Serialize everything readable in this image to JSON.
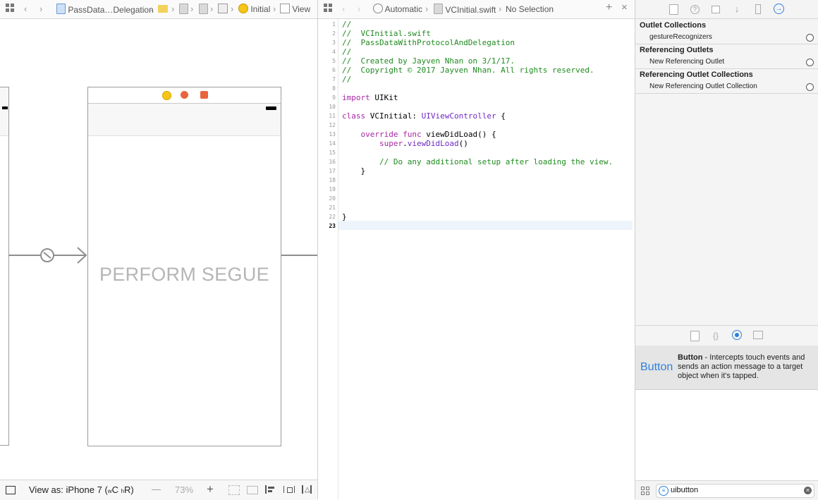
{
  "storyboard_jumpbar": {
    "project": "PassData…Delegation",
    "scene": "Initial",
    "view": "View"
  },
  "scene": {
    "title": "PERFORM SEGUE"
  },
  "storyboard_bottom": {
    "view_as": "View as: iPhone 7 (",
    "size_w": "w",
    "size_c": "C",
    "size_h": "h",
    "size_r": "R)",
    "minus": "—",
    "zoom": "73%",
    "plus": "+"
  },
  "code_jumpbar": {
    "mode": "Automatic",
    "file": "VCInitial.swift",
    "selection": "No Selection",
    "add": "+",
    "close": "×"
  },
  "code_lines": [
    {
      "n": "1",
      "text": "//",
      "style": "com"
    },
    {
      "n": "2",
      "text": "//  VCInitial.swift",
      "style": "com"
    },
    {
      "n": "3",
      "text": "//  PassDataWithProtocolAndDelegation",
      "style": "com"
    },
    {
      "n": "4",
      "text": "//",
      "style": "com"
    },
    {
      "n": "5",
      "text": "//  Created by Jayven Nhan on 3/1/17.",
      "style": "com"
    },
    {
      "n": "6",
      "text": "//  Copyright © 2017 Jayven Nhan. All rights reserved.",
      "style": "com"
    },
    {
      "n": "7",
      "text": "//",
      "style": "com"
    },
    {
      "n": "8",
      "text": "",
      "style": "plain"
    },
    {
      "n": "9",
      "text": "import UIKit",
      "style": "import"
    },
    {
      "n": "10",
      "text": "",
      "style": "plain"
    },
    {
      "n": "11",
      "text": "class VCInitial: UIViewController {",
      "style": "class"
    },
    {
      "n": "12",
      "text": "",
      "style": "plain"
    },
    {
      "n": "13",
      "text": "    override func viewDidLoad() {",
      "style": "override"
    },
    {
      "n": "14",
      "text": "        super.viewDidLoad()",
      "style": "super"
    },
    {
      "n": "15",
      "text": "",
      "style": "plain"
    },
    {
      "n": "16",
      "text": "        // Do any additional setup after loading the view.",
      "style": "com"
    },
    {
      "n": "17",
      "text": "    }",
      "style": "plain"
    },
    {
      "n": "18",
      "text": "",
      "style": "plain"
    },
    {
      "n": "19",
      "text": "",
      "style": "plain"
    },
    {
      "n": "20",
      "text": "",
      "style": "plain"
    },
    {
      "n": "21",
      "text": "",
      "style": "plain"
    },
    {
      "n": "22",
      "text": "}",
      "style": "plain"
    },
    {
      "n": "23",
      "text": "",
      "style": "plain"
    }
  ],
  "connections": {
    "outlet_collections": "Outlet Collections",
    "gesture_recognizers": "gestureRecognizers",
    "referencing_outlets": "Referencing Outlets",
    "new_referencing_outlet": "New Referencing Outlet",
    "referencing_outlet_collections": "Referencing Outlet Collections",
    "new_referencing_outlet_collection": "New Referencing Outlet Collection"
  },
  "library_item": {
    "preview": "Button",
    "name": "Button",
    "description": " - Intercepts touch events and sends an action message to a target object when it's tapped."
  },
  "filter": {
    "value": "uibutton"
  },
  "colors": {
    "accent": "#2f7fd8",
    "comment": "#1f8a1f",
    "keyword": "#a626a4"
  }
}
